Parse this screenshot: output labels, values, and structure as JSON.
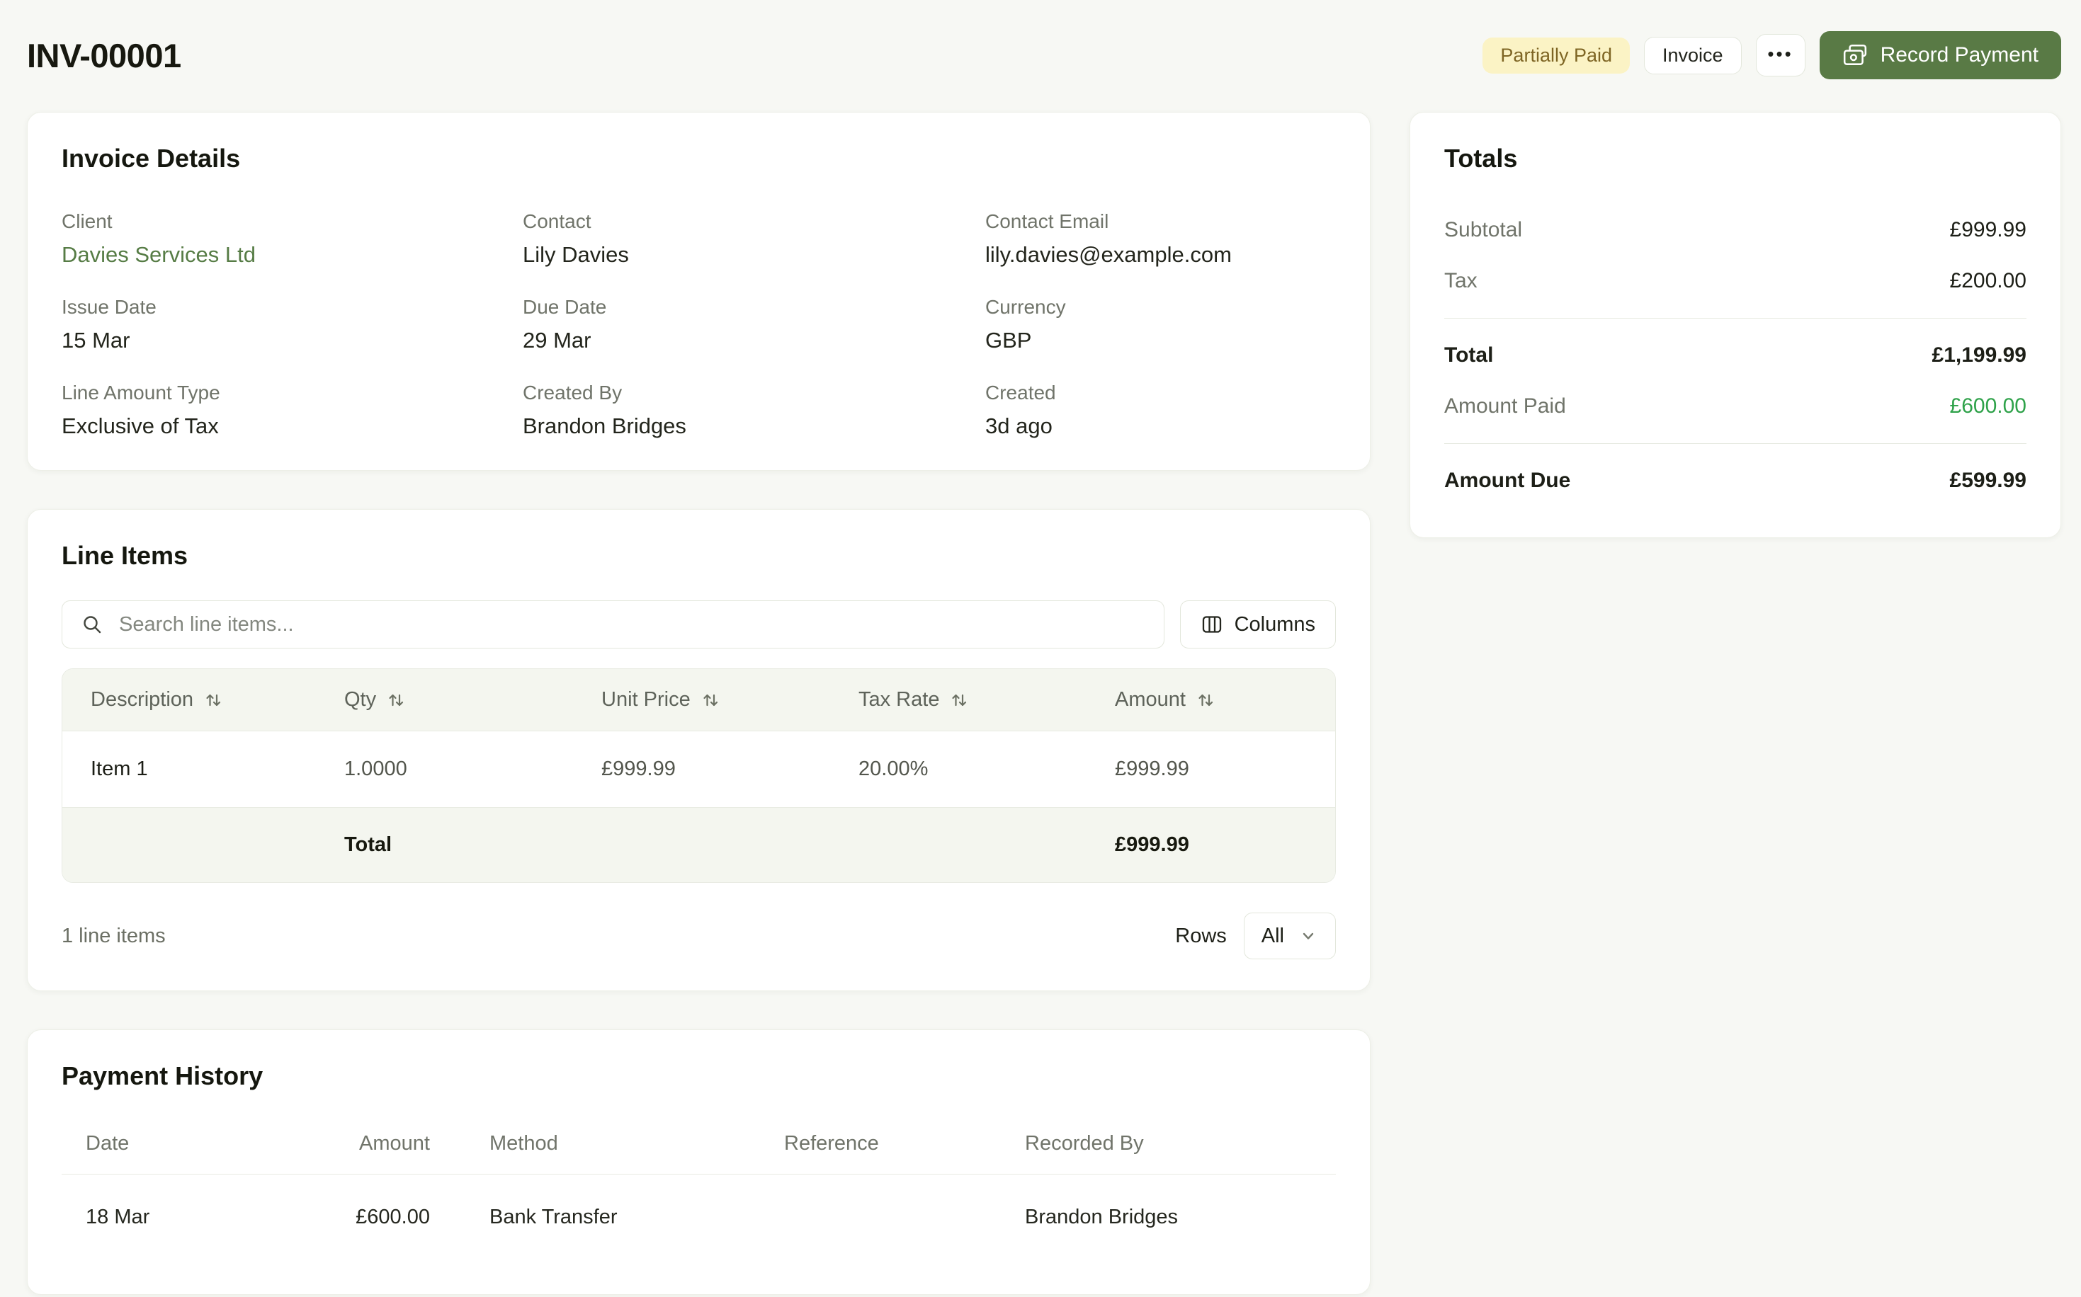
{
  "header": {
    "title": "INV-00001",
    "status_badge": "Partially Paid",
    "type_badge": "Invoice",
    "record_payment_label": "Record Payment"
  },
  "invoice_details": {
    "title": "Invoice Details",
    "fields": [
      {
        "label": "Client",
        "value": "Davies Services Ltd"
      },
      {
        "label": "Contact",
        "value": "Lily Davies"
      },
      {
        "label": "Contact Email",
        "value": "lily.davies@example.com"
      },
      {
        "label": "Issue Date",
        "value": "15 Mar"
      },
      {
        "label": "Due Date",
        "value": "29 Mar"
      },
      {
        "label": "Currency",
        "value": "GBP"
      },
      {
        "label": "Line Amount Type",
        "value": "Exclusive of Tax"
      },
      {
        "label": "Created By",
        "value": "Brandon Bridges"
      },
      {
        "label": "Created",
        "value": "3d ago"
      }
    ]
  },
  "totals": {
    "title": "Totals",
    "subtotal": {
      "label": "Subtotal",
      "value": "£999.99"
    },
    "tax": {
      "label": "Tax",
      "value": "£200.00"
    },
    "total": {
      "label": "Total",
      "value": "£1,199.99"
    },
    "amount_paid": {
      "label": "Amount Paid",
      "value": "£600.00"
    },
    "amount_due": {
      "label": "Amount Due",
      "value": "£599.99"
    }
  },
  "line_items": {
    "title": "Line Items",
    "search_placeholder": "Search line items...",
    "columns_button_label": "Columns",
    "table": {
      "headers": [
        "Description",
        "Qty",
        "Unit Price",
        "Tax Rate",
        "Amount"
      ],
      "rows": [
        {
          "description": "Item 1",
          "qty": "1.0000",
          "unit_price": "£999.99",
          "tax_rate": "20.00%",
          "amount": "£999.99"
        }
      ],
      "total_label": "Total",
      "total_amount": "£999.99"
    },
    "footer": {
      "count": "1 line items",
      "rows_label": "Rows",
      "rows_value": "All"
    }
  },
  "payment_history": {
    "title": "Payment History",
    "headers": [
      "Date",
      "Amount",
      "Method",
      "Reference",
      "Recorded By"
    ],
    "rows": [
      {
        "date": "18 Mar",
        "amount": "£600.00",
        "method": "Bank Transfer",
        "reference": "",
        "recorded_by": "Brandon Bridges"
      }
    ]
  },
  "icons": {
    "more": "•••"
  },
  "colors": {
    "accent_green": "#597a45",
    "link_green": "#567c45",
    "paid_green": "#2fa24a",
    "status_badge_bg": "#fbf3c5",
    "status_badge_text": "#7e6524",
    "page_bg": "#f7f8f4"
  }
}
